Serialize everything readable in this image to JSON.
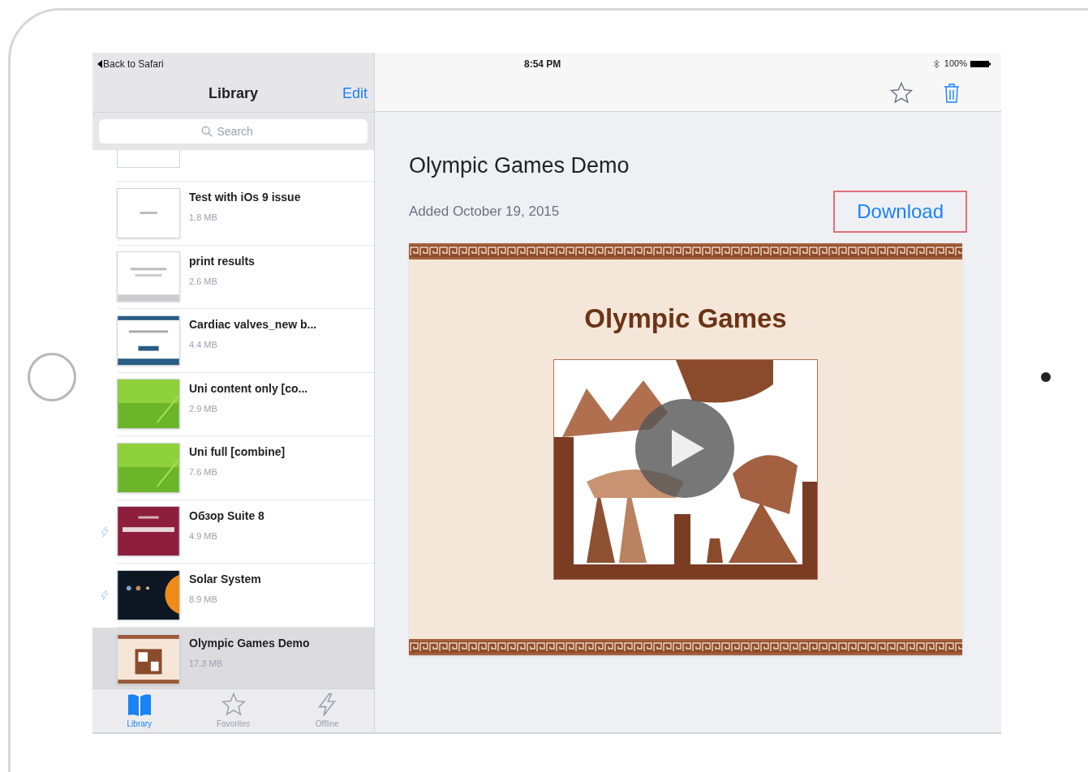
{
  "sidebar": {
    "back_link": "Back to Safari",
    "title": "Library",
    "edit": "Edit",
    "search": {
      "placeholder": "Search"
    },
    "items": [
      {
        "title": "Test with iOs 9 issue",
        "size": "1.8 MB",
        "offline": false,
        "selected": false,
        "kind": "text"
      },
      {
        "title": "print results",
        "size": "2.6 MB",
        "offline": false,
        "selected": false,
        "kind": "grey"
      },
      {
        "title": "Cardiac valves_new b...",
        "size": "4.4 MB",
        "offline": false,
        "selected": false,
        "kind": "blue"
      },
      {
        "title": "Uni content only [co...",
        "size": "2.9 MB",
        "offline": false,
        "selected": false,
        "kind": "green"
      },
      {
        "title": "Uni full [combine]",
        "size": "7.6 MB",
        "offline": false,
        "selected": false,
        "kind": "green"
      },
      {
        "title": "Обзор Suite 8",
        "size": "4.9 MB",
        "offline": true,
        "selected": false,
        "kind": "maroon"
      },
      {
        "title": "Solar System",
        "size": "8.9 MB",
        "offline": true,
        "selected": false,
        "kind": "space"
      },
      {
        "title": "Olympic Games Demo",
        "size": "17.3 MB",
        "offline": false,
        "selected": true,
        "kind": "olympic"
      }
    ],
    "tabs": [
      {
        "label": "Library",
        "kind": "book",
        "selected": true
      },
      {
        "label": "Favorites",
        "kind": "star",
        "selected": false
      },
      {
        "label": "Offline",
        "kind": "bolt",
        "selected": false
      }
    ]
  },
  "status_bar": {
    "time": "8:54 PM",
    "battery": "100%"
  },
  "detail": {
    "title": "Olympic Games Demo",
    "added": "Added October 19, 2015",
    "download": "Download",
    "slide_title": "Olympic Games"
  }
}
